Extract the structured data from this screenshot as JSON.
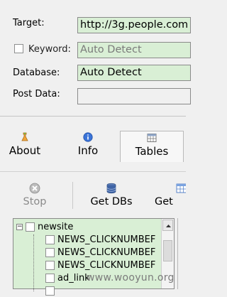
{
  "form": {
    "target_label": "Target:",
    "target_value": "http://3g.people.com",
    "keyword_label": "Keyword:",
    "keyword_value": "Auto Detect",
    "database_label": "Database:",
    "database_value": "Auto Detect",
    "postdata_label": "Post Data:",
    "postdata_value": ""
  },
  "tabs": [
    {
      "label": "About",
      "icon": "flask-icon"
    },
    {
      "label": "Info",
      "icon": "info-icon"
    },
    {
      "label": "Tables",
      "icon": "grid-icon",
      "active": true
    }
  ],
  "toolbar": {
    "stop_label": "Stop",
    "getdbs_label": "Get DBs",
    "gettables_label": "Get Ta"
  },
  "tree": {
    "root": "newsite",
    "items": [
      "NEWS_CLICKNUMBEF",
      "NEWS_CLICKNUMBEF",
      "NEWS_CLICKNUMBEF",
      "ad_link"
    ]
  },
  "watermark": "www.wooyun.org",
  "colors": {
    "field_bg": "#d9efd5",
    "window_bg": "#f0f0f0"
  }
}
